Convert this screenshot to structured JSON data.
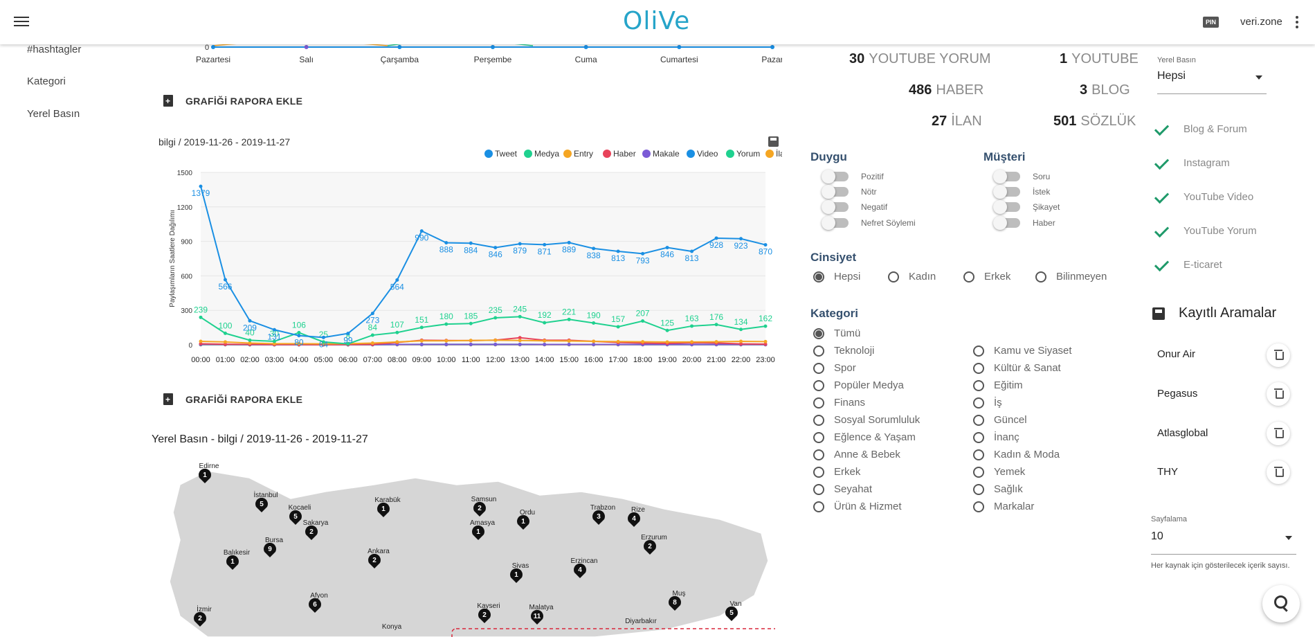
{
  "app": {
    "logo": "OliVe",
    "pin_badge": "PIN",
    "user": "veri.zone"
  },
  "sidebar": {
    "items": [
      {
        "label": "#hashtagler"
      },
      {
        "label": "Kategori"
      },
      {
        "label": "Yerel Basın"
      }
    ]
  },
  "report_button_label": "GRAFİĞİ RAPORA EKLE",
  "weekly_chart": {
    "days": [
      "Pazartesi",
      "Salı",
      "Çarşamba",
      "Perşembe",
      "Cuma",
      "Cumartesi",
      "Pazar"
    ],
    "zero_label": "0"
  },
  "chart_data": {
    "type": "line",
    "title": "bilgi / 2019-11-26 - 2019-11-27",
    "ylabel": "Paylaşımların Saatlere Dağılımı",
    "ylim": [
      0,
      1500
    ],
    "yticks": [
      0,
      300,
      600,
      900,
      1200,
      1500
    ],
    "legend_position": "top-right",
    "categories": [
      "00:00",
      "01:00",
      "02:00",
      "03:00",
      "04:00",
      "05:00",
      "06:00",
      "07:00",
      "08:00",
      "09:00",
      "10:00",
      "11:00",
      "12:00",
      "13:00",
      "14:00",
      "15:00",
      "16:00",
      "17:00",
      "18:00",
      "19:00",
      "20:00",
      "21:00",
      "22:00",
      "23:00"
    ],
    "series": [
      {
        "name": "Tweet",
        "color": "#1a8fe3",
        "values": [
          1379,
          566,
          209,
          131,
          80,
          64,
          99,
          273,
          564,
          990,
          888,
          884,
          846,
          879,
          871,
          889,
          838,
          813,
          793,
          846,
          813,
          928,
          923,
          870
        ],
        "labels": true
      },
      {
        "name": "Medya",
        "color": "#1fd18f",
        "values": [
          239,
          100,
          40,
          30,
          106,
          25,
          8,
          84,
          107,
          151,
          180,
          185,
          235,
          245,
          192,
          221,
          190,
          157,
          207,
          125,
          163,
          176,
          134,
          162
        ],
        "labels": true
      },
      {
        "name": "Entry",
        "color": "#f5a623",
        "values": [
          30,
          25,
          15,
          10,
          10,
          8,
          10,
          15,
          25,
          35,
          35,
          38,
          40,
          38,
          35,
          33,
          30,
          28,
          26,
          24,
          25,
          26,
          30,
          28
        ],
        "labels": false
      },
      {
        "name": "Haber",
        "color": "#e8435a",
        "values": [
          9,
          5,
          3,
          2,
          2,
          1,
          2,
          3,
          20,
          40,
          38,
          37,
          41,
          62,
          40,
          40,
          30,
          20,
          15,
          12,
          18,
          16,
          8,
          6
        ],
        "labels": false
      },
      {
        "name": "Makale",
        "color": "#7b5bd6",
        "values": [
          5,
          3,
          2,
          1,
          1,
          1,
          1,
          2,
          3,
          4,
          4,
          4,
          4,
          4,
          3,
          3,
          3,
          3,
          2,
          2,
          2,
          2,
          2,
          2
        ],
        "labels": false
      },
      {
        "name": "Video",
        "color": "#1a8fe3",
        "values": [
          2,
          2,
          1,
          1,
          1,
          1,
          1,
          1,
          2,
          2,
          2,
          2,
          2,
          2,
          2,
          2,
          2,
          2,
          2,
          2,
          2,
          2,
          2,
          2
        ],
        "labels": false
      },
      {
        "name": "Yorum",
        "color": "#1fd18f",
        "values": [
          3,
          2,
          1,
          1,
          1,
          1,
          1,
          2,
          3,
          4,
          4,
          4,
          4,
          4,
          3,
          3,
          3,
          3,
          2,
          2,
          2,
          2,
          2,
          2
        ],
        "labels": false
      },
      {
        "name": "İlan",
        "color": "#f5a623",
        "values": [
          1,
          1,
          1,
          0,
          0,
          0,
          0,
          1,
          1,
          1,
          1,
          1,
          1,
          1,
          1,
          1,
          1,
          1,
          1,
          1,
          1,
          1,
          1,
          1
        ],
        "labels": false
      }
    ]
  },
  "map": {
    "title": "Yerel Basın - bilgi / 2019-11-26 - 2019-11-27",
    "pins": [
      {
        "city": "Edirne",
        "count": "1"
      },
      {
        "city": "İstanbul",
        "count": "5"
      },
      {
        "city": "Kocaeli",
        "count": "5"
      },
      {
        "city": "Sakarya",
        "count": "2"
      },
      {
        "city": "Bursa",
        "count": "9"
      },
      {
        "city": "Balıkesir",
        "count": "1"
      },
      {
        "city": "Karabük",
        "count": "1"
      },
      {
        "city": "Ankara",
        "count": "2"
      },
      {
        "city": "Samsun",
        "count": "2"
      },
      {
        "city": "Amasya",
        "count": "1"
      },
      {
        "city": "Ordu",
        "count": "1"
      },
      {
        "city": "Trabzon",
        "count": "3"
      },
      {
        "city": "Rize",
        "count": "4"
      },
      {
        "city": "Erzurum",
        "count": "2"
      },
      {
        "city": "Erzincan",
        "count": "4"
      },
      {
        "city": "Sivas",
        "count": "1"
      },
      {
        "city": "Muş",
        "count": "8"
      },
      {
        "city": "Van",
        "count": "5"
      },
      {
        "city": "Afyon",
        "count": "6"
      },
      {
        "city": "İzmir",
        "count": "2"
      },
      {
        "city": "Kayseri",
        "count": "2"
      },
      {
        "city": "Malatya",
        "count": "11"
      },
      {
        "city": "Konya",
        "count": ""
      },
      {
        "city": "Diyarbakır",
        "count": ""
      }
    ]
  },
  "stats": [
    {
      "value": "30",
      "label": "YOUTUBE YORUM"
    },
    {
      "value": "1",
      "label": "YOUTUBE"
    },
    {
      "value": "486",
      "label": "HABER"
    },
    {
      "value": "3",
      "label": "BLOG"
    },
    {
      "value": "27",
      "label": "İLAN"
    },
    {
      "value": "501",
      "label": "SÖZLÜK"
    }
  ],
  "duygu": {
    "title": "Duygu",
    "items": [
      "Pozitif",
      "Nötr",
      "Negatif",
      "Nefret Söylemi"
    ]
  },
  "musteri": {
    "title": "Müşteri",
    "items": [
      "Soru",
      "İstek",
      "Şikayet",
      "Haber"
    ]
  },
  "cinsiyet": {
    "title": "Cinsiyet",
    "options": [
      "Hepsi",
      "Kadın",
      "Erkek",
      "Bilinmeyen"
    ],
    "selected": "Hepsi"
  },
  "kategori": {
    "title": "Kategori",
    "col1": [
      "Tümü",
      "Teknoloji",
      "Spor",
      "Popüler Medya",
      "Finans",
      "Sosyal Sorumluluk",
      "Eğlence & Yaşam",
      "Anne & Bebek",
      "Erkek",
      "Seyahat",
      "Ürün & Hizmet"
    ],
    "col2": [
      "Kamu ve Siyaset",
      "Kültür & Sanat",
      "Eğitim",
      "İş",
      "Güncel",
      "İnanç",
      "Kadın & Moda",
      "Yemek",
      "Sağlık",
      "Markalar"
    ],
    "selected": "Tümü"
  },
  "yerel_basin_select": {
    "label": "Yerel Basın",
    "value": "Hepsi"
  },
  "sources": [
    "Blog & Forum",
    "Instagram",
    "YouTube Video",
    "YouTube Yorum",
    "E-ticaret"
  ],
  "saved_searches": {
    "title": "Kayıtlı Aramalar",
    "items": [
      "Onur Air",
      "Pegasus",
      "Atlasglobal",
      "THY"
    ]
  },
  "paging": {
    "label": "Sayfalama",
    "value": "10",
    "helper": "Her kaynak için gösterilecek içerik sayısı."
  },
  "colors": {
    "accent": "#26a4c9",
    "check": "#1f9a6a",
    "heading": "#35506e"
  }
}
